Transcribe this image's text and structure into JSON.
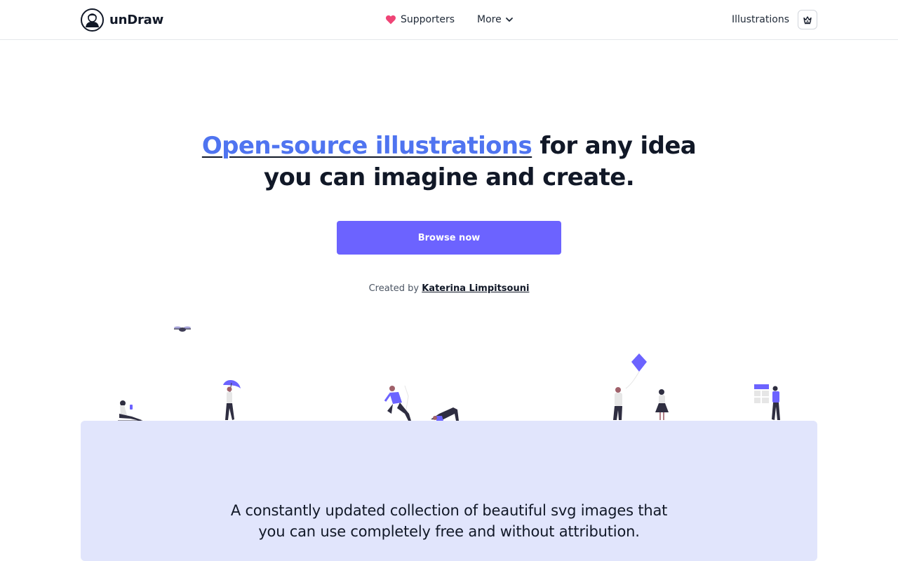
{
  "header": {
    "brand": "unDraw",
    "nav": {
      "supporters": "Supporters",
      "more": "More"
    },
    "illustrations": "Illustrations"
  },
  "hero": {
    "title_accent": "Open-source illustrations",
    "title_rest_1": " for any idea",
    "title_line_2": "you can imagine and create.",
    "cta": "Browse now",
    "credit_prefix": "Created by ",
    "credit_author": "Katerina Limpitsouni"
  },
  "panel": {
    "line_1": "A constantly updated collection of beautiful svg images that",
    "line_2": "you can use completely free and without attribution."
  },
  "colors": {
    "accent": "#6c63ff",
    "accent_text": "#4f74f0",
    "heart": "#ef4476",
    "panel_bg": "#e1e5fc"
  },
  "icons": [
    "logo-avatar-icon",
    "heart-icon",
    "chevron-down-icon",
    "crown-icon"
  ]
}
